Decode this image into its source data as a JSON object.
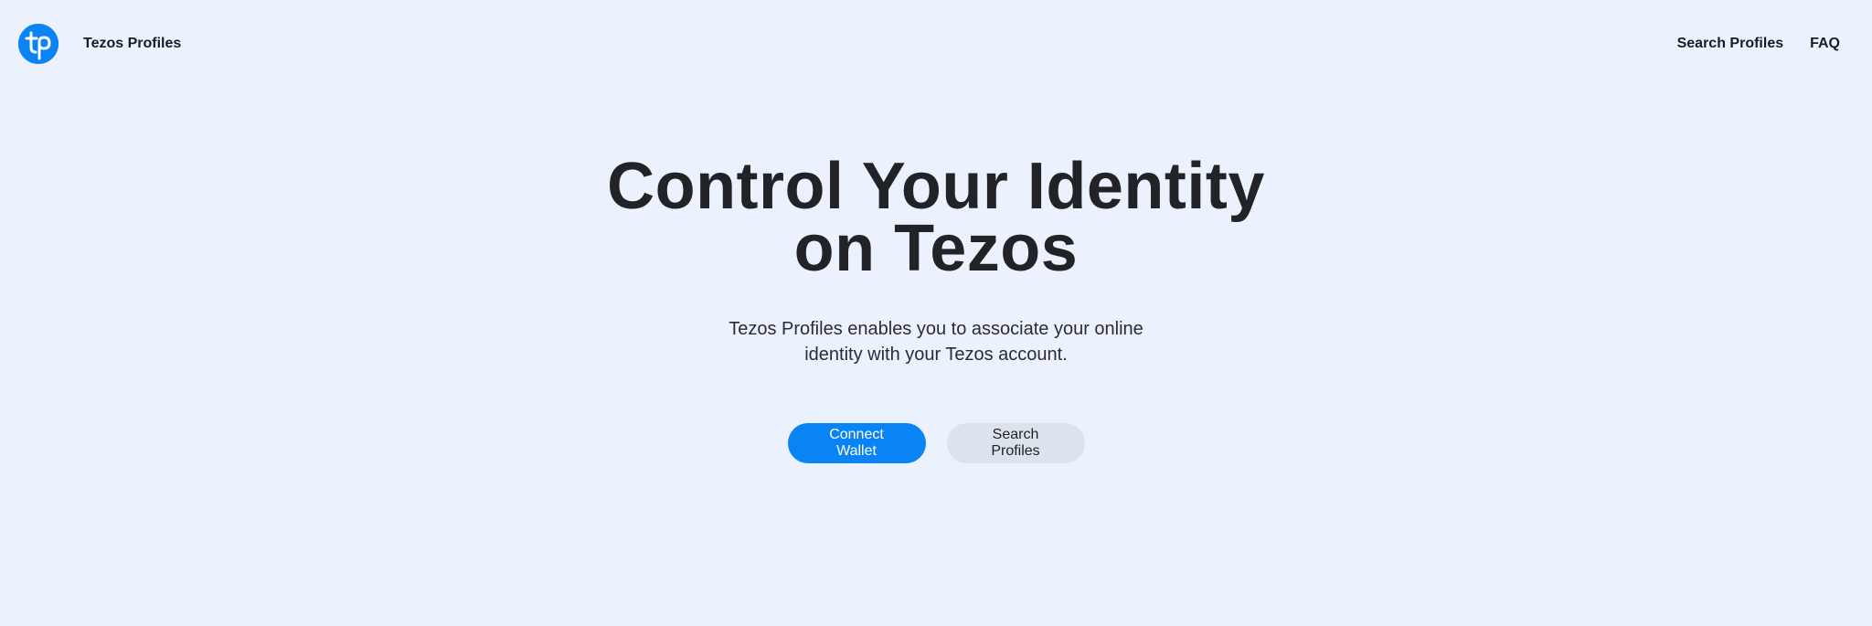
{
  "nav": {
    "logo_icon": "tezos-profiles-logo-icon",
    "brand": "Tezos Profiles",
    "links": [
      {
        "label": "Search Profiles"
      },
      {
        "label": "FAQ"
      }
    ]
  },
  "hero": {
    "title_line1": "Control Your Identity",
    "title_line2": "on Tezos",
    "subtitle_line1": "Tezos Profiles enables you to associate your online",
    "subtitle_line2": "identity with your Tezos account.",
    "primary_button": "Connect Wallet",
    "secondary_button": "Search Profiles"
  },
  "colors": {
    "background": "#ebf2fd",
    "accent": "#0a84f5",
    "secondary_button": "#dde3ec",
    "text": "#1f2124"
  }
}
